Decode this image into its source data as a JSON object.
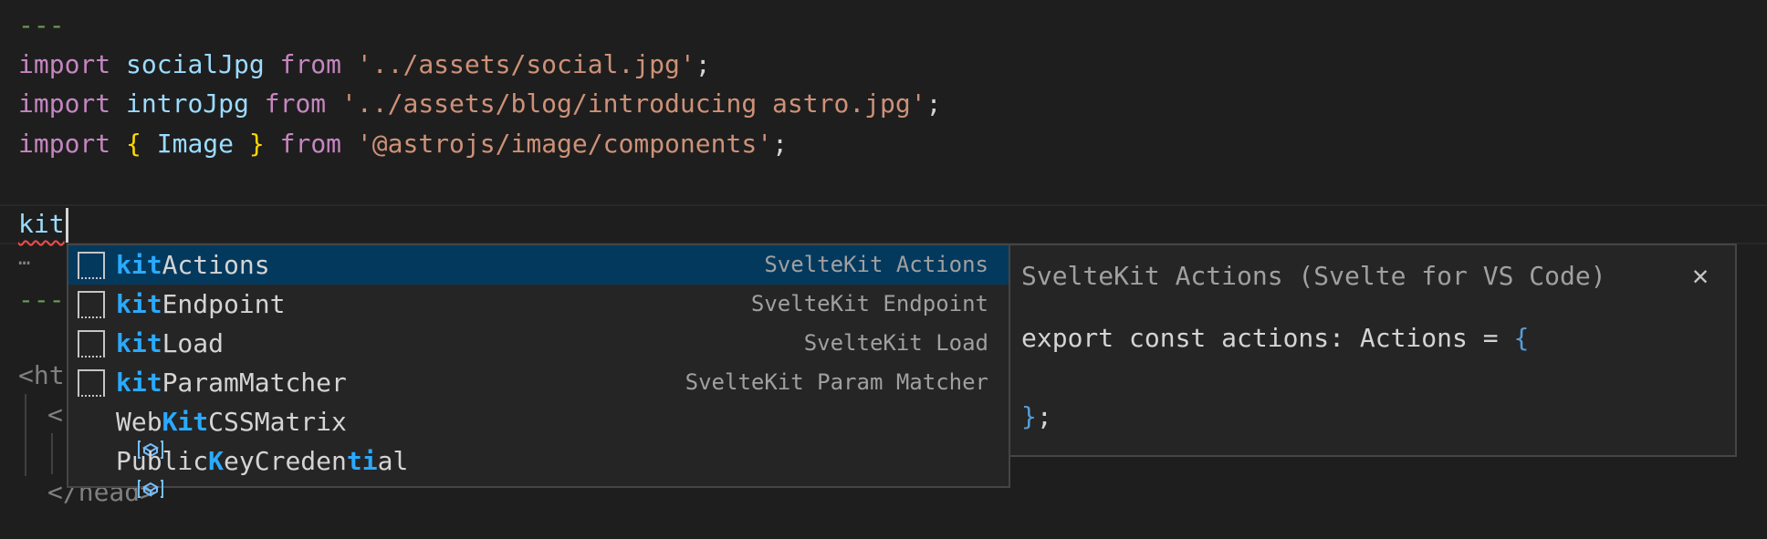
{
  "editor": {
    "frontmatter_open": "---",
    "line_import1": {
      "kw": "import",
      "name": "socialJpg",
      "from": "from",
      "path": "'../assets/social.jpg'",
      "semi": ";"
    },
    "line_import2": {
      "kw": "import",
      "name": "introJpg",
      "from": "from",
      "path": "'../assets/blog/introducing astro.jpg'",
      "semi": ";"
    },
    "line_import3": {
      "kw": "import",
      "open": "{",
      "name": "Image",
      "close": "}",
      "from": "from",
      "path": "'@astrojs/image/components'",
      "semi": ";"
    },
    "current_text": "kit",
    "fold_ellipsis": "…",
    "frontmatter_close_partial": "---",
    "html_partial": "<ht",
    "head_open_partial": "<",
    "head_close_partial": "</head>"
  },
  "suggest": {
    "items": [
      {
        "highlight": "kit",
        "rest": "Actions",
        "detail": "SvelteKit Actions",
        "icon": "snippet-icon",
        "selected": true
      },
      {
        "highlight": "kit",
        "rest": "Endpoint",
        "detail": "SvelteKit Endpoint",
        "icon": "snippet-icon"
      },
      {
        "highlight": "kit",
        "rest": "Load",
        "detail": "SvelteKit Load",
        "icon": "snippet-icon"
      },
      {
        "highlight": "kit",
        "rest": "ParamMatcher",
        "detail": "SvelteKit Param Matcher",
        "icon": "snippet-icon"
      },
      {
        "parts": [
          "Web",
          "Kit",
          "CSSMatrix"
        ],
        "icon": "variable-icon"
      },
      {
        "parts": [
          "Public",
          "K",
          "eyCreden",
          "ti",
          "al"
        ],
        "icon": "variable-icon"
      }
    ]
  },
  "docs": {
    "title": "SvelteKit Actions (Svelte for VS Code)",
    "close_glyph": "✕",
    "code_line1": "export const actions: Actions = ",
    "code_open": "{",
    "code_close": "}",
    "code_semi": ";"
  },
  "colors": {
    "background": "#1e1e1e",
    "keyword": "#c586c0",
    "variable": "#9cdcfe",
    "string": "#ce9178",
    "match_highlight": "#2aaaff",
    "selected_row": "#04395e"
  }
}
